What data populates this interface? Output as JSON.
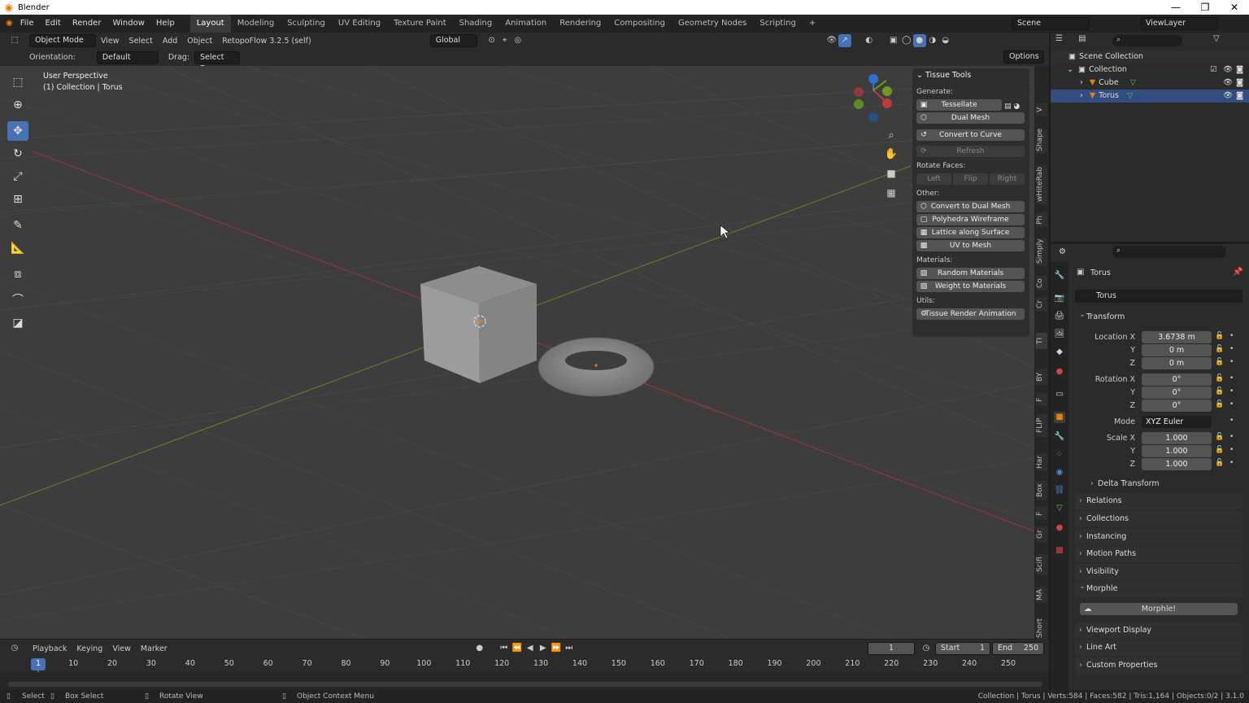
{
  "window": {
    "title": "Blender",
    "minimize": "—",
    "restore": "❐",
    "close": "✕"
  },
  "menu": [
    "File",
    "Edit",
    "Render",
    "Window",
    "Help"
  ],
  "workspaces": [
    "Layout",
    "Modeling",
    "Sculpting",
    "UV Editing",
    "Texture Paint",
    "Shading",
    "Animation",
    "Rendering",
    "Compositing",
    "Geometry Nodes",
    "Scripting",
    "+"
  ],
  "scene": "Scene",
  "viewlayer": "ViewLayer",
  "header": {
    "mode": "Object Mode",
    "view": "View",
    "select": "Select",
    "add": "Add",
    "object": "Object",
    "addon": "RetopoFlow 3.2.5 (self)",
    "transform": "Global"
  },
  "header2": {
    "orientation_label": "Orientation:",
    "orientation": "Default",
    "drag_label": "Drag:",
    "drag": "Select Box",
    "options": "Options"
  },
  "viewport": {
    "perspective": "User Perspective",
    "collection": "(1) Collection | Torus"
  },
  "tissue": {
    "title": "Tissue Tools",
    "generate": "Generate:",
    "tessellate": "Tessellate",
    "dual_mesh": "Dual Mesh",
    "convert_curve": "Convert to Curve",
    "refresh": "Refresh",
    "rotate_faces": "Rotate Faces:",
    "left": "Left",
    "flip": "Flip",
    "right": "Right",
    "other": "Other:",
    "convert_dual": "Convert to Dual Mesh",
    "polyhedra": "Polyhedra Wireframe",
    "lattice": "Lattice along Surface",
    "uv_mesh": "UV to Mesh",
    "materials": "Materials:",
    "random_mat": "Random Materials",
    "weight_mat": "Weight to Materials",
    "utils": "Utils:",
    "render_anim": "Tissue Render Animation"
  },
  "side_tabs": [
    "Short",
    "MA",
    "Scifi",
    "Gr",
    "F",
    "Box",
    "Har",
    "FLIP",
    "F",
    "BY",
    "TI",
    "Cr",
    "Co",
    "Simply",
    "Ph",
    "wHiteRab",
    "Shape",
    "V"
  ],
  "outliner": {
    "scene_collection": "Scene Collection",
    "collection": "Collection",
    "cube": "Cube",
    "torus": "Torus"
  },
  "props": {
    "object_name": "Torus",
    "data_name": "Torus",
    "transform": "Transform",
    "location_x_label": "Location X",
    "location_x": "3.6738 m",
    "y_label": "Y",
    "location_y": "0 m",
    "z_label": "Z",
    "location_z": "0 m",
    "rotation_x_label": "Rotation X",
    "rotation_x": "0°",
    "rotation_y": "0°",
    "rotation_z": "0°",
    "mode_label": "Mode",
    "mode": "XYZ Euler",
    "scale_x_label": "Scale X",
    "scale_x": "1.000",
    "scale_y": "1.000",
    "scale_z": "1.000",
    "delta": "Delta Transform",
    "relations": "Relations",
    "collections": "Collections",
    "instancing": "Instancing",
    "motion_paths": "Motion Paths",
    "visibility": "Visibility",
    "morphle": "Morphle",
    "morphle_btn": "Morphle!",
    "viewport_display": "Viewport Display",
    "line_art": "Line Art",
    "custom_props": "Custom Properties"
  },
  "timeline": {
    "playback": "Playback",
    "keying": "Keying",
    "view": "View",
    "marker": "Marker",
    "frame": "1",
    "start_label": "Start",
    "start": "1",
    "end_label": "End",
    "end": "250",
    "ticks": [
      "1",
      "10",
      "20",
      "30",
      "40",
      "50",
      "60",
      "70",
      "80",
      "90",
      "100",
      "110",
      "120",
      "130",
      "140",
      "150",
      "160",
      "170",
      "180",
      "190",
      "200",
      "210",
      "220",
      "230",
      "240",
      "250"
    ]
  },
  "status": {
    "select": "Select",
    "box_select": "Box Select",
    "rotate": "Rotate View",
    "context": "Object Context Menu",
    "stats": "Collection | Torus | Verts:584 | Faces:582 | Tris:1,164 | Objects:0/2 | 3.1.0"
  },
  "colors": {
    "accent": "#4772b3",
    "orange": "#e87d0d",
    "x_axis": "#c0393b",
    "y_axis": "#6b9a1f",
    "z_axis": "#2e6fd0"
  }
}
